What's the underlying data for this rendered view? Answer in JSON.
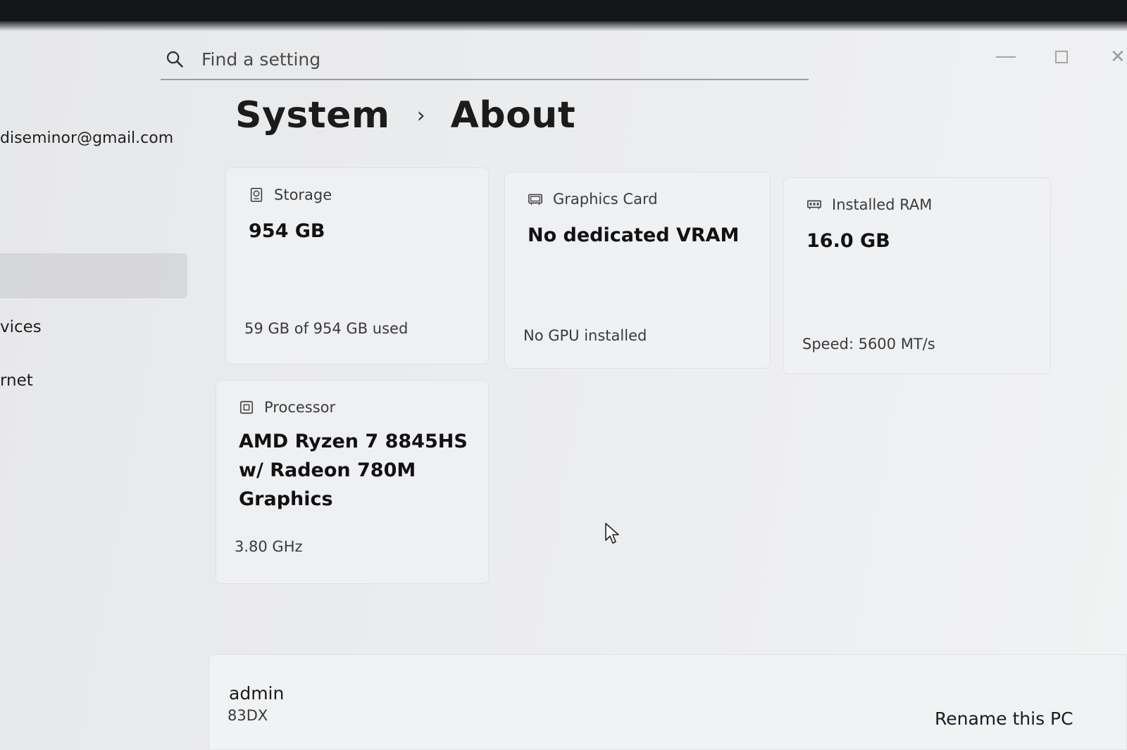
{
  "search": {
    "placeholder": "Find a setting"
  },
  "account": {
    "email": "diseminor@gmail.com"
  },
  "sidebar": {
    "items": [
      {
        "label": "vices"
      },
      {
        "label": "rnet"
      }
    ]
  },
  "breadcrumb": {
    "parent": "System",
    "separator": "›",
    "current": "About"
  },
  "specs": {
    "storage": {
      "label": "Storage",
      "value": "954 GB",
      "detail": "59 GB of 954 GB used"
    },
    "graphics": {
      "label": "Graphics Card",
      "value": "No dedicated VRAM",
      "detail": "No GPU installed"
    },
    "ram": {
      "label": "Installed RAM",
      "value": "16.0 GB",
      "detail": "Speed: 5600 MT/s"
    },
    "processor": {
      "label": "Processor",
      "value": "AMD Ryzen 7 8845HS w/ Radeon 780M Graphics",
      "detail": "3.80 GHz"
    }
  },
  "device": {
    "name": "admin",
    "model": "83DX",
    "rename_label": "Rename this PC"
  },
  "window_controls": {
    "close_glyph": "✕"
  },
  "icons": [
    "search-icon",
    "storage-icon",
    "graphics-card-icon",
    "ram-icon",
    "processor-icon",
    "mouse-cursor-icon"
  ]
}
